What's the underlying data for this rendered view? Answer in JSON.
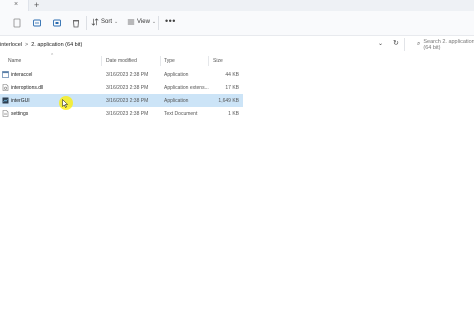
{
  "tabs": {
    "close_glyph": "×",
    "add_glyph": "+"
  },
  "toolbar": {
    "sort_label": "Sort",
    "view_label": "View",
    "more_glyph": "•••",
    "icons": [
      "new-item-icon",
      "cut-icon",
      "copy-icon",
      "paste-icon",
      "share-icon",
      "delete-icon",
      "sort-icon",
      "view-icon"
    ]
  },
  "address": {
    "crumbs": [
      "interlocel",
      "2. application (64 bit)"
    ],
    "separator": ">",
    "chevron": "⌄",
    "refresh": "↻"
  },
  "search": {
    "placeholder": "Search 2. application (64 bit)"
  },
  "columns": {
    "name": "Name",
    "date": "Date modified",
    "type": "Type",
    "size": "Size"
  },
  "files": [
    {
      "name": "interaccel",
      "date": "3/16/2023 2:38 PM",
      "type": "Application",
      "size": "44 KB",
      "icon": "app-icon",
      "selected": false
    },
    {
      "name": "interoptions.dll",
      "date": "3/16/2023 2:38 PM",
      "type": "Application extens...",
      "size": "17 KB",
      "icon": "dll-icon",
      "selected": false
    },
    {
      "name": "interGUI",
      "date": "3/16/2023 2:38 PM",
      "type": "Application",
      "size": "1,649 KB",
      "icon": "app-gui-icon",
      "selected": true
    },
    {
      "name": "settings",
      "date": "3/16/2023 2:38 PM",
      "type": "Text Document",
      "size": "1 KB",
      "icon": "text-doc-icon",
      "selected": false
    }
  ],
  "colors": {
    "selection": "#cce4f7",
    "cursor_highlight": "#fff000",
    "toolbar_bg": "#f9fafc"
  }
}
